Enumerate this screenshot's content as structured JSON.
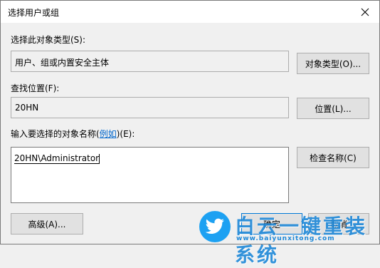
{
  "window": {
    "title": "选择用户或组"
  },
  "object_types": {
    "label": "选择此对象类型(S):",
    "value": "用户、组或内置安全主体",
    "button": "对象类型(O)..."
  },
  "location": {
    "label": "查找位置(F):",
    "value": "20HN",
    "button": "位置(L)..."
  },
  "names": {
    "label_prefix": "输入要选择的对象名称(",
    "label_link": "例如",
    "label_suffix": ")(E):",
    "value": "20HN\\Administrator",
    "check_button": "检查名称(C)"
  },
  "footer": {
    "advanced": "高级(A)...",
    "ok": "确定",
    "cancel": "取消"
  },
  "watermark": {
    "text": "白云一键重装系统",
    "url": "www.baiyunxitong.com",
    "color": "#1e88d8"
  },
  "colors": {
    "accent": "#0078d7",
    "button_bg": "#e1e1e1",
    "window_bg": "#f0f0f0"
  }
}
